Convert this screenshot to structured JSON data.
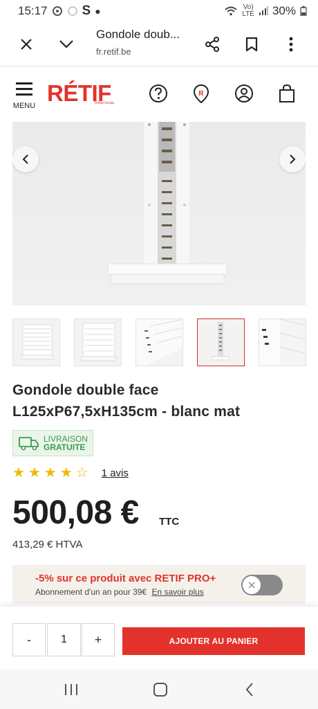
{
  "status_bar": {
    "time": "15:17",
    "carrier_icon": "S",
    "network_label_top": "Vo)",
    "network_label_bottom": "LTE",
    "battery": "30%"
  },
  "browser": {
    "title": "Gondole doub...",
    "url": "fr.retif.be"
  },
  "header": {
    "menu_label": "MENU",
    "logo_text": "RÉTIF",
    "logo_subtext": "Retail Group"
  },
  "product": {
    "title_line1": "Gondole double face",
    "title_line2": "L125xP67,5xH135cm - blanc mat",
    "delivery_line1": "LIVRAISON",
    "delivery_line2": "GRATUITE",
    "rating": 4,
    "rating_max": 5,
    "reviews": "1 avis",
    "price": "500,08 €",
    "price_unit": "TTC",
    "price_htva": "413,29 € HTVA",
    "thumbnail_count": 5,
    "active_thumbnail": 4
  },
  "promo": {
    "title": "-5% sur ce produit avec RETIF PRO+",
    "subtitle": "Abonnement d'un an pour 39€",
    "link": "En savoir plus"
  },
  "cart": {
    "minus": "-",
    "quantity": "1",
    "plus": "+",
    "add_label": "AJOUTER AU PANIER"
  },
  "colors": {
    "brand_red": "#e3322b",
    "delivery_green": "#3a9a46",
    "star_yellow": "#f2b705",
    "promo_bg": "#f4f1eb"
  }
}
